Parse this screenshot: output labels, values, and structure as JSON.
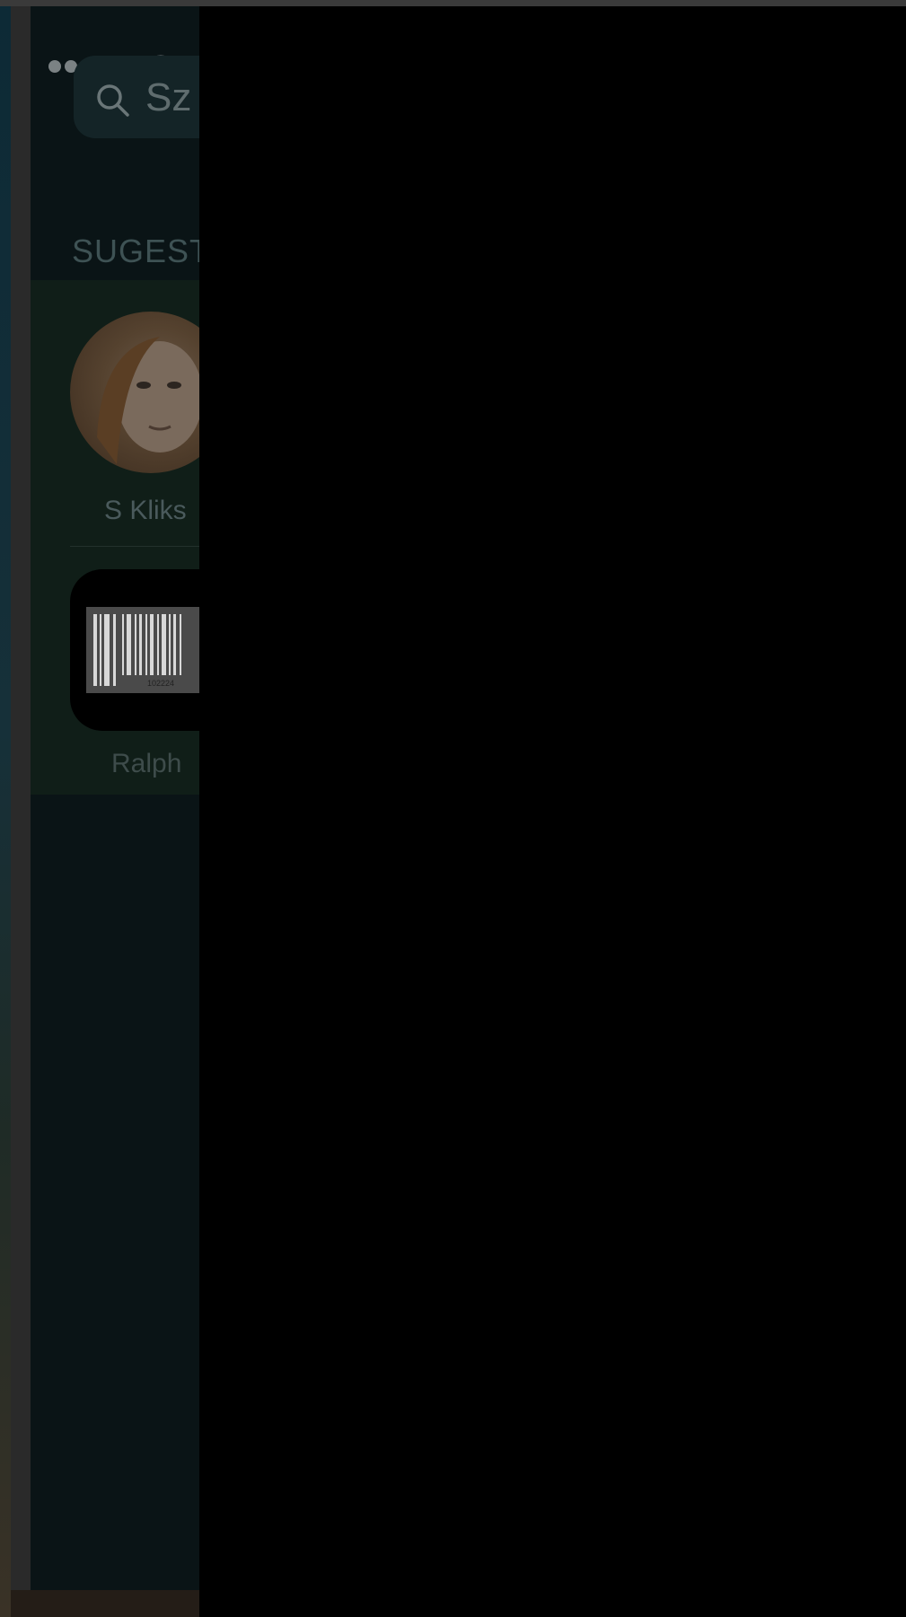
{
  "search": {
    "text": "Sz"
  },
  "suggestions": {
    "title": "SUGEST",
    "contact": {
      "name": "S Kliks"
    },
    "app": {
      "name": "Ralph",
      "barcode_number": "102224"
    }
  },
  "icons": [
    "search-icon",
    "wifi-icon",
    "barcode-icon"
  ],
  "colors": {
    "overlay": "#000000",
    "panel": "#0a1416",
    "suggest_panel": "#101e18"
  }
}
